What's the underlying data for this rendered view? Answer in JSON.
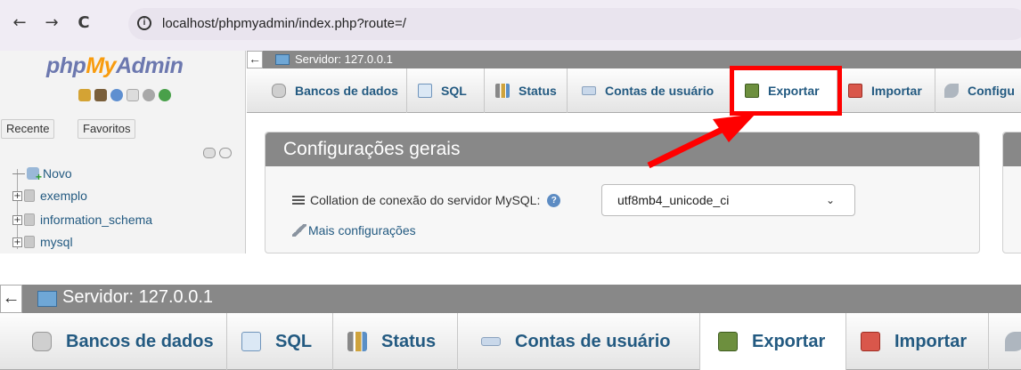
{
  "browser": {
    "url": "localhost/phpmyadmin/index.php?route=/",
    "back_icon": "←",
    "forward_icon": "→",
    "reload_icon": "C",
    "info_icon": "i"
  },
  "sidebar": {
    "logo": {
      "php": "php",
      "my": "My",
      "admin": "Admin"
    },
    "recent_label": "Recente",
    "favorites_label": "Favoritos",
    "tree": [
      {
        "label": "Novo"
      },
      {
        "label": "exemplo"
      },
      {
        "label": "information_schema"
      },
      {
        "label": "mysql"
      }
    ]
  },
  "server": {
    "label": "Servidor: 127.0.0.1"
  },
  "tabs": [
    {
      "label": "Bancos de dados",
      "icon": "database-icon"
    },
    {
      "label": "SQL",
      "icon": "sql-icon"
    },
    {
      "label": "Status",
      "icon": "status-icon"
    },
    {
      "label": "Contas de usuário",
      "icon": "users-icon"
    },
    {
      "label": "Exportar",
      "icon": "export-icon"
    },
    {
      "label": "Importar",
      "icon": "import-icon"
    },
    {
      "label": "Configu",
      "icon": "wrench-icon"
    }
  ],
  "general_settings": {
    "title": "Configurações gerais",
    "collation_label": "Collation de conexão do servidor MySQL:",
    "collation_value": "utf8mb4_unicode_ci",
    "more_settings": "Mais configurações"
  },
  "colors": {
    "highlight": "#ff0000",
    "link": "#235a81",
    "header_gray": "#888888"
  }
}
